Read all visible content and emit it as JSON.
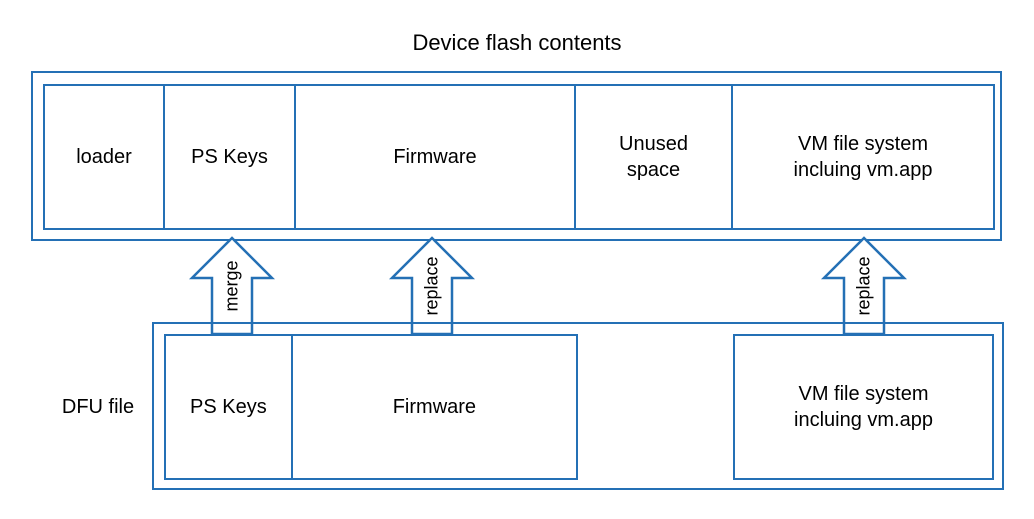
{
  "title": "Device flash contents",
  "colors": {
    "stroke": "#2470b5",
    "text": "#000000",
    "background": "#ffffff"
  },
  "flash": {
    "label": "Device flash contents",
    "cells": [
      {
        "label": "loader"
      },
      {
        "label": "PS Keys"
      },
      {
        "label": "Firmware"
      },
      {
        "label": "Unused\nspace"
      },
      {
        "label": "VM file system\nincluing vm.app"
      }
    ]
  },
  "dfu": {
    "label": "DFU file",
    "group_a": [
      {
        "label": "PS Keys"
      },
      {
        "label": "Firmware"
      }
    ],
    "group_b": [
      {
        "label": "VM file system\nincluing vm.app"
      }
    ]
  },
  "arrows": [
    {
      "label": "merge",
      "from": "dfu-ps-keys",
      "to": "flash-ps-keys"
    },
    {
      "label": "replace",
      "from": "dfu-firmware",
      "to": "flash-firmware"
    },
    {
      "label": "replace",
      "from": "dfu-vm-fs",
      "to": "flash-vm-fs"
    }
  ]
}
